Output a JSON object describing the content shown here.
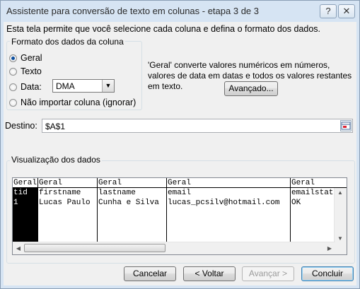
{
  "window": {
    "title": "Assistente para conversão de texto em colunas - etapa 3 de 3",
    "help_label": "?",
    "close_label": "✕"
  },
  "intro": "Esta tela permite que você selecione cada coluna e defina o formato dos dados.",
  "format_group": {
    "legend": "Formato dos dados da coluna",
    "options": [
      {
        "label": "Geral",
        "selected": true
      },
      {
        "label": "Texto",
        "selected": false
      },
      {
        "label": "Data:",
        "selected": false
      },
      {
        "label": "Não importar coluna (ignorar)",
        "selected": false
      }
    ],
    "date_format": "DMA"
  },
  "description": "'Geral' converte valores numéricos em números, valores de data em datas e todos os valores restantes em texto.",
  "advanced_button": "Avançado...",
  "destination": {
    "label": "Destino:",
    "value": "$A$1"
  },
  "preview_group": {
    "legend": "Visualização dos dados",
    "headers": [
      "Geral",
      "Geral",
      "Geral",
      "Geral",
      "Geral"
    ],
    "rows": [
      [
        "tid",
        "firstname",
        "lastname",
        "email",
        "emailstatus"
      ],
      [
        "1",
        "Lucas Paulo",
        "Cunha e Silva",
        "lucas_pcsilv@hotmail.com",
        "OK"
      ]
    ]
  },
  "buttons": {
    "cancel": "Cancelar",
    "back": "< Voltar",
    "next": "Avançar >",
    "finish": "Concluir"
  }
}
